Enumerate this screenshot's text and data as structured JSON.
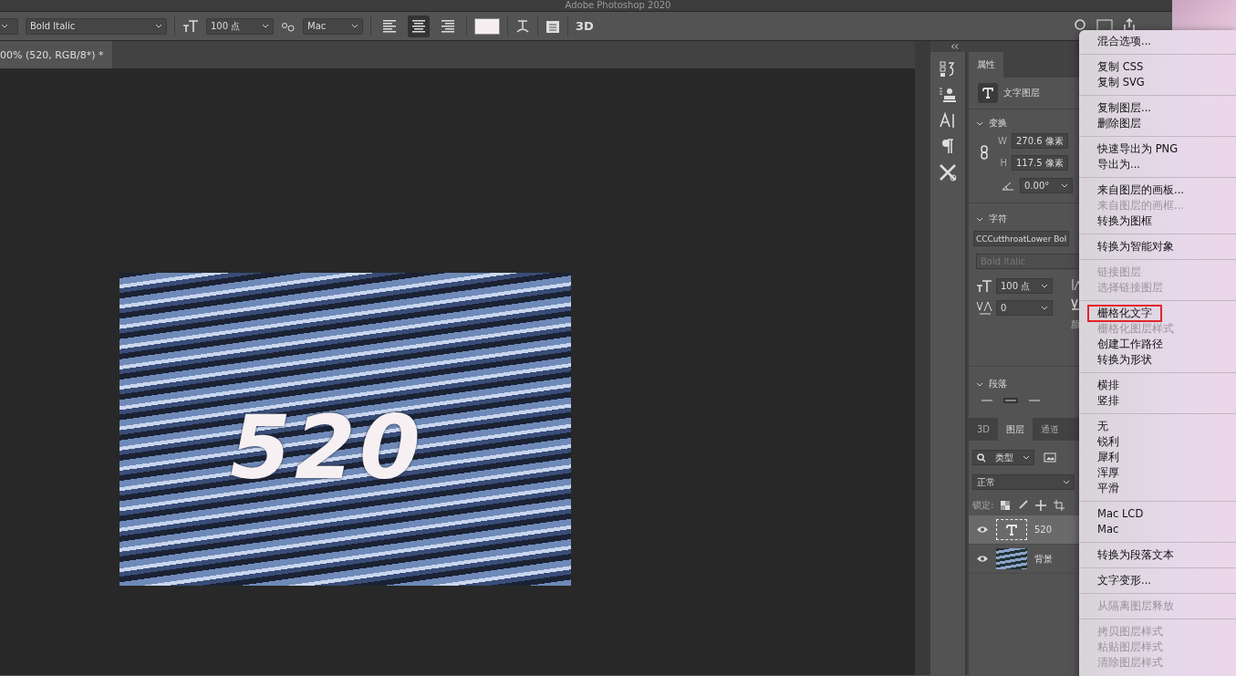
{
  "window": {
    "title": "Adobe Photoshop 2020"
  },
  "options_bar": {
    "font_style": "Bold Italic",
    "font_size": "100 点",
    "antialias": "Mac",
    "align": [
      {
        "kind": "left",
        "selected": false
      },
      {
        "kind": "center",
        "selected": true
      },
      {
        "kind": "right",
        "selected": false
      }
    ],
    "text_3d": "3D"
  },
  "document_tab": {
    "title": "00% (520, RGB/8*) *"
  },
  "canvas": {
    "layer_text": "520"
  },
  "properties": {
    "tab": "属性",
    "layer_kind": "文字图层",
    "transform": {
      "title": "变换",
      "w_label": "W",
      "w": "270.6 像素",
      "h_label": "H",
      "h": "117.5 像素",
      "angle": "0.00°"
    },
    "character": {
      "title": "字符",
      "font": "CCCutthroatLower Bol",
      "style": "Bold Italic",
      "size": "100 点",
      "tracking": "0",
      "color_label": "颜"
    },
    "paragraph": {
      "title": "段落"
    }
  },
  "layers_panel": {
    "tabs": [
      {
        "label": "3D",
        "selected": false
      },
      {
        "label": "图层",
        "selected": true
      },
      {
        "label": "通道",
        "selected": false
      }
    ],
    "filter": "类型",
    "blend_mode": "正常",
    "lock_label": "锁定:",
    "layers": [
      {
        "name": "520",
        "kind": "text",
        "visible": true,
        "selected": true
      },
      {
        "name": "背景",
        "kind": "image",
        "visible": true,
        "selected": false
      }
    ]
  },
  "context_menu": {
    "groups": [
      [
        {
          "label": "混合选项...",
          "disabled": false
        }
      ],
      [
        {
          "label": "复制 CSS",
          "disabled": false
        },
        {
          "label": "复制 SVG",
          "disabled": false
        }
      ],
      [
        {
          "label": "复制图层...",
          "disabled": false
        },
        {
          "label": "删除图层",
          "disabled": false
        }
      ],
      [
        {
          "label": "快速导出为 PNG",
          "disabled": false
        },
        {
          "label": "导出为...",
          "disabled": false
        }
      ],
      [
        {
          "label": "来自图层的画板...",
          "disabled": false
        },
        {
          "label": "来自图层的画框...",
          "disabled": true
        },
        {
          "label": "转换为图框",
          "disabled": false
        }
      ],
      [
        {
          "label": "转换为智能对象",
          "disabled": false
        }
      ],
      [
        {
          "label": "链接图层",
          "disabled": true
        },
        {
          "label": "选择链接图层",
          "disabled": true
        }
      ],
      [
        {
          "label": "栅格化文字",
          "disabled": false,
          "outlined": true
        },
        {
          "label": "栅格化图层样式",
          "disabled": true
        },
        {
          "label": "创建工作路径",
          "disabled": false
        },
        {
          "label": "转换为形状",
          "disabled": false
        }
      ],
      [
        {
          "label": "横排",
          "disabled": false
        },
        {
          "label": "竖排",
          "disabled": false
        }
      ],
      [
        {
          "label": "无",
          "disabled": false
        },
        {
          "label": "锐利",
          "disabled": false
        },
        {
          "label": "犀利",
          "disabled": false
        },
        {
          "label": "浑厚",
          "disabled": false
        },
        {
          "label": "平滑",
          "disabled": false
        }
      ],
      [
        {
          "label": "Mac LCD",
          "disabled": false
        },
        {
          "label": "Mac",
          "disabled": false
        }
      ],
      [
        {
          "label": "转换为段落文本",
          "disabled": false
        }
      ],
      [
        {
          "label": "文字变形...",
          "disabled": false
        }
      ],
      [
        {
          "label": "从隔离图层释放",
          "disabled": true
        }
      ],
      [
        {
          "label": "拷贝图层样式",
          "disabled": true
        },
        {
          "label": "粘贴图层样式",
          "disabled": true
        },
        {
          "label": "清除图层样式",
          "disabled": true
        }
      ]
    ]
  }
}
